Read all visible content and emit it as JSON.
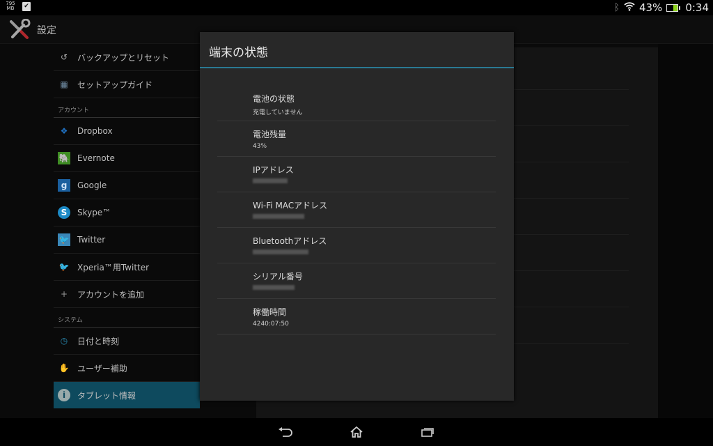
{
  "status_bar": {
    "memory_label": "795 MB",
    "battery_percent": "43%",
    "battery_level": 0.43,
    "time": "0:34",
    "icons": [
      "memory-icon",
      "task-icon",
      "bluetooth-icon",
      "wifi-icon",
      "battery-icon"
    ]
  },
  "action_bar": {
    "title": "設定",
    "icon": "settings-tools-icon"
  },
  "sidebar": {
    "items": [
      {
        "type": "item",
        "label": "バックアップとリセット",
        "icon": "backup-restore-icon"
      },
      {
        "type": "item",
        "label": "セットアップガイド",
        "icon": "setup-guide-icon"
      },
      {
        "type": "header",
        "label": "アカウント"
      },
      {
        "type": "item",
        "label": "Dropbox",
        "icon": "dropbox-icon"
      },
      {
        "type": "item",
        "label": "Evernote",
        "icon": "evernote-icon"
      },
      {
        "type": "item",
        "label": "Google",
        "icon": "google-icon"
      },
      {
        "type": "item",
        "label": "Skype™",
        "icon": "skype-icon"
      },
      {
        "type": "item",
        "label": "Twitter",
        "icon": "twitter-icon"
      },
      {
        "type": "item",
        "label": "Xperia™用Twitter",
        "icon": "xperia-twitter-icon"
      },
      {
        "type": "item",
        "label": "アカウントを追加",
        "icon": "plus-icon"
      },
      {
        "type": "header",
        "label": "システム"
      },
      {
        "type": "item",
        "label": "日付と時刻",
        "icon": "clock-icon"
      },
      {
        "type": "item",
        "label": "ユーザー補助",
        "icon": "hand-icon"
      },
      {
        "type": "item",
        "label": "タブレット情報",
        "icon": "info-icon",
        "selected": true
      }
    ]
  },
  "dialog": {
    "title": "端末の状態",
    "accent_color": "#2a7a93",
    "rows": [
      {
        "label": "電池の状態",
        "value": "充電していません"
      },
      {
        "label": "電池残量",
        "value": "43%"
      },
      {
        "label": "IPアドレス",
        "value": "",
        "redacted": true
      },
      {
        "label": "Wi-Fi MACアドレス",
        "value": "",
        "redacted": true
      },
      {
        "label": "Bluetoothアドレス",
        "value": "",
        "redacted": true
      },
      {
        "label": "シリアル番号",
        "value": "",
        "redacted": true
      },
      {
        "label": "稼働時間",
        "value": "4240:07:50"
      }
    ]
  },
  "nav_bar": {
    "buttons": [
      "back-icon",
      "home-icon",
      "recent-apps-icon"
    ]
  },
  "colors": {
    "selected_item": "#0e4a5e",
    "dialog_bg": "#282828",
    "battery_fill": "#8bd11c"
  }
}
